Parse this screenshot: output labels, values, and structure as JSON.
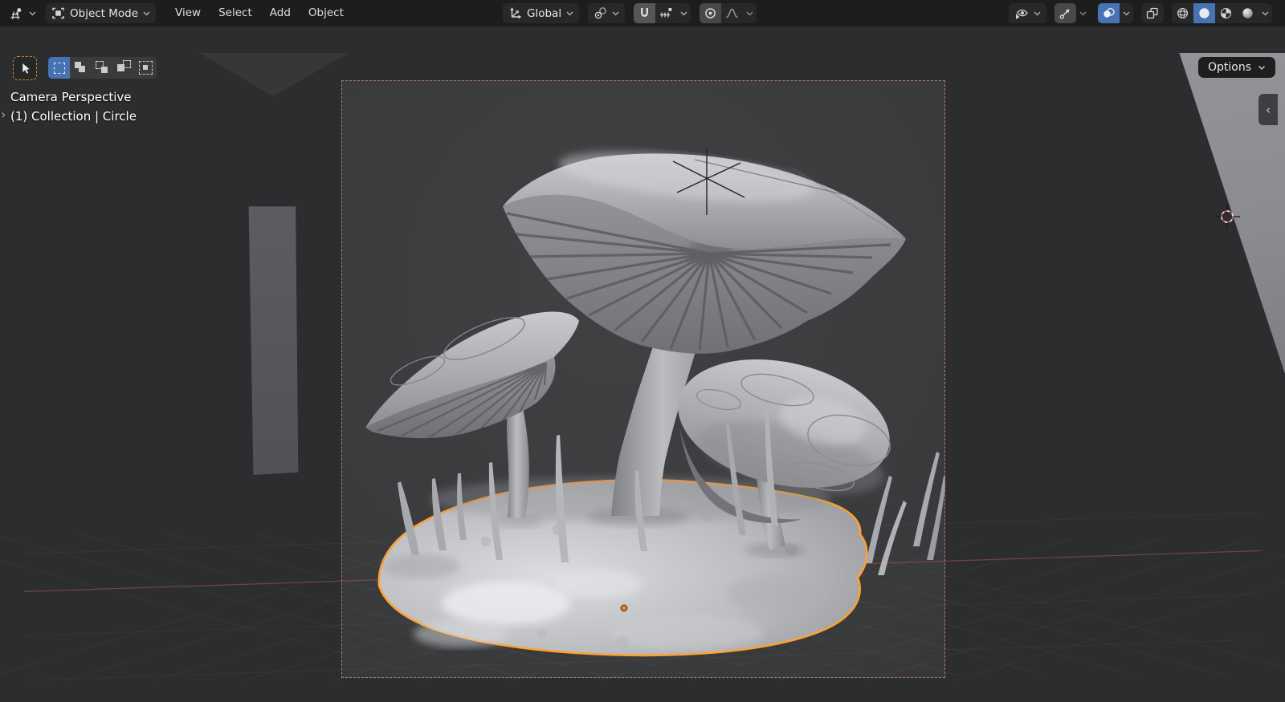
{
  "header": {
    "editor_type_icon": "3d-viewport-editor-icon",
    "mode_selector": {
      "icon": "object-mode-icon",
      "label": "Object Mode"
    },
    "menus": [
      {
        "label": "View"
      },
      {
        "label": "Select"
      },
      {
        "label": "Add"
      },
      {
        "label": "Object"
      }
    ],
    "transform_orientation": {
      "icon": "orientation-global-icon",
      "label": "Global"
    },
    "pivot_icon": "pivot-point-icon",
    "snap": {
      "magnet_icon": "snap-magnet-icon",
      "target_icon": "snap-increment-icon",
      "magnet_on": true
    },
    "proportional": {
      "dot_icon": "proportional-editing-icon",
      "falloff_icon": "falloff-curve-icon"
    },
    "right_icons": [
      "show-object-types-icon",
      "gizmos-icon",
      "overlays-icon",
      "xray-toggle-icon",
      "shading-wireframe-icon",
      "shading-solid-icon",
      "shading-material-icon",
      "shading-rendered-icon"
    ],
    "active_shading": "solid"
  },
  "tool_header": {
    "active_tool_icon": "tweak-cursor-icon",
    "select_mode_icons": [
      "select-set-icon",
      "select-extend-icon",
      "select-subtract-icon",
      "select-invert-icon",
      "select-intersect-icon"
    ],
    "active_select_mode": 0,
    "options_label": "Options"
  },
  "viewport": {
    "view_label": "Camera Perspective",
    "context_label": "(1) Collection | Circle",
    "sidebar_collapse_glyph": "‹",
    "toolshelf_expand_glyph": "›"
  },
  "colors": {
    "header_bg": "#1d1d1d",
    "accent_blue": "#4772b3",
    "selection_outline": "#ffa030",
    "camera_border": "#b27878",
    "viewport_bg": "#2c2d2e",
    "camera_view_bg": "#3b3c3e",
    "backdrop_gray": "#8c8d8f",
    "axis_x": "#bb5555",
    "axis_y": "#5f9f62",
    "origin_dot": "#d98a28"
  }
}
